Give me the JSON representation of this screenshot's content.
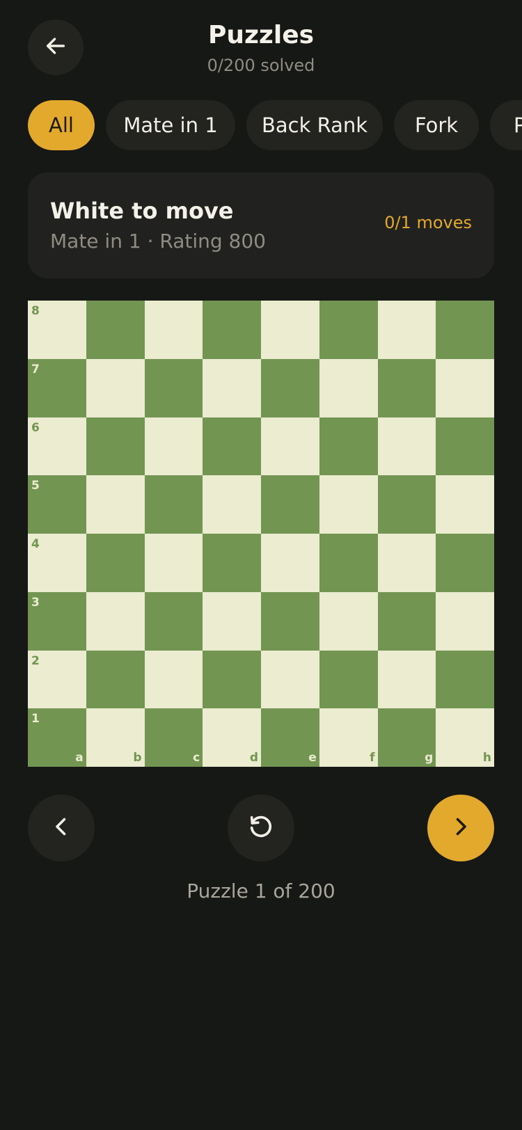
{
  "header": {
    "title": "Puzzles",
    "subtitle": "0/200 solved",
    "back_icon": "arrow-left-icon"
  },
  "filters": {
    "items": [
      {
        "label": "All",
        "active": true
      },
      {
        "label": "Mate in 1",
        "active": false
      },
      {
        "label": "Back Rank",
        "active": false
      },
      {
        "label": "Fork",
        "active": false
      },
      {
        "label": "P",
        "active": false
      }
    ]
  },
  "puzzle_info": {
    "title": "White to move",
    "subtitle": "Mate in 1 · Rating 800",
    "progress": "0/1 moves"
  },
  "board": {
    "ranks": [
      "8",
      "7",
      "6",
      "5",
      "4",
      "3",
      "2",
      "1"
    ],
    "files": [
      "a",
      "b",
      "c",
      "d",
      "e",
      "f",
      "g",
      "h"
    ],
    "light_color": "#ebecd0",
    "dark_color": "#739552"
  },
  "controls": {
    "prev_icon": "chevron-left-icon",
    "reset_icon": "rotate-ccw-icon",
    "next_icon": "chevron-right-icon"
  },
  "footer": {
    "counter": "Puzzle 1 of 200"
  },
  "colors": {
    "background": "#161815",
    "surface": "#232420",
    "accent": "#e3a92c",
    "muted_text": "#8f8c82"
  }
}
